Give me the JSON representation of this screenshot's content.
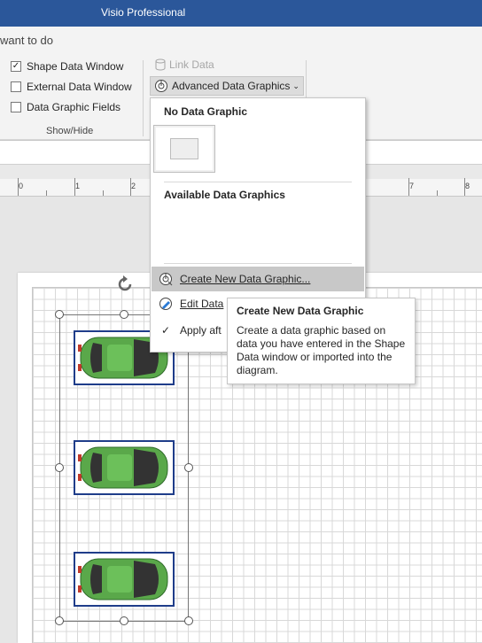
{
  "window": {
    "title": "Visio Professional"
  },
  "tellme": {
    "text": "want to do"
  },
  "ribbon": {
    "checkboxes": [
      {
        "label": "Shape Data Window",
        "checked": true
      },
      {
        "label": "External Data Window",
        "checked": false
      },
      {
        "label": "Data Graphic Fields",
        "checked": false
      }
    ],
    "group_label": "Show/Hide",
    "link_data_label": "Link Data",
    "advanced_button_label": "Advanced Data Graphics"
  },
  "ruler": {
    "labels": [
      "0",
      "1",
      "2",
      "7",
      "8"
    ]
  },
  "dropdown": {
    "no_graphic_heading": "No Data Graphic",
    "available_heading": "Available Data Graphics",
    "items": [
      {
        "label": "Create New Data Graphic...",
        "icon": "create-graphic-icon"
      },
      {
        "label": "Edit Data",
        "icon": "edit-graphic-icon"
      },
      {
        "label": "Apply aft",
        "icon": "checkmark-icon"
      }
    ]
  },
  "tooltip": {
    "title": "Create New Data Graphic",
    "body": "Create a data graphic based on data you have entered in the Shape Data window or imported into the diagram."
  },
  "colors": {
    "titlebar": "#2b579a",
    "car_body": "#5aa84a",
    "car_border": "#1f3d8a"
  }
}
